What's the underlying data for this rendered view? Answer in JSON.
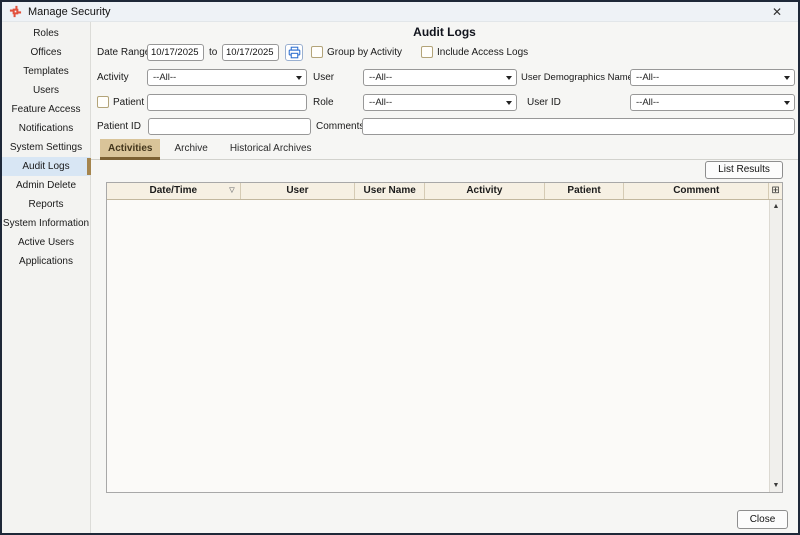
{
  "window": {
    "title": "Manage Security"
  },
  "icons": {
    "close": "✕",
    "sort_indicator": "▽",
    "column_chooser": "⊞",
    "scroll_up": "▲",
    "scroll_down": "▼"
  },
  "sidebar": {
    "items": [
      {
        "label": "Roles"
      },
      {
        "label": "Offices"
      },
      {
        "label": "Templates"
      },
      {
        "label": "Users"
      },
      {
        "label": "Feature Access"
      },
      {
        "label": "Notifications"
      },
      {
        "label": "System Settings"
      },
      {
        "label": "Audit Logs",
        "selected": true
      },
      {
        "label": "Admin Delete"
      },
      {
        "label": "Reports"
      },
      {
        "label": "System Information"
      },
      {
        "label": "Active Users"
      },
      {
        "label": "Applications"
      }
    ]
  },
  "main": {
    "heading": "Audit Logs",
    "filters": {
      "date_range_label": "Date Range",
      "date_from": "10/17/2025",
      "to_label": "to",
      "date_to": "10/17/2025",
      "group_by_activity_label": "Group by Activity",
      "group_by_activity_checked": false,
      "include_access_logs_label": "Include Access Logs",
      "include_access_logs_checked": false,
      "activity_label": "Activity",
      "activity_value": "--All--",
      "user_label": "User",
      "user_value": "--All--",
      "user_demographics_label": "User Demographics Name",
      "user_demographics_value": "--All--",
      "patient_label": "Patient",
      "patient_checked": false,
      "patient_value": "",
      "role_label": "Role",
      "role_value": "--All--",
      "user_id_label": "User ID",
      "user_id_value": "--All--",
      "patient_id_label": "Patient ID",
      "patient_id_value": "",
      "comments_label": "Comments",
      "comments_value": ""
    },
    "tabs": [
      {
        "label": "Activities",
        "selected": true
      },
      {
        "label": "Archive",
        "selected": false
      },
      {
        "label": "Historical Archives",
        "selected": false
      }
    ],
    "list_results_label": "List Results",
    "table": {
      "columns": [
        "Date/Time",
        "User",
        "User Name",
        "Activity",
        "Patient",
        "Comment"
      ],
      "rows": []
    },
    "close_label": "Close"
  },
  "colors": {
    "window_border": "#1e2838",
    "titlebar_bg": "#eef2f6",
    "sidebar_selected_bg": "#d8e6f4",
    "accent_gold_bar": "#a5854e",
    "tab_selected_bg": "#d9c499",
    "tab_underline": "#7c6133",
    "table_header_bg": "#f6f0e3",
    "app_icon_red": "#e2503c",
    "printer_blue": "#2e6fd0"
  }
}
